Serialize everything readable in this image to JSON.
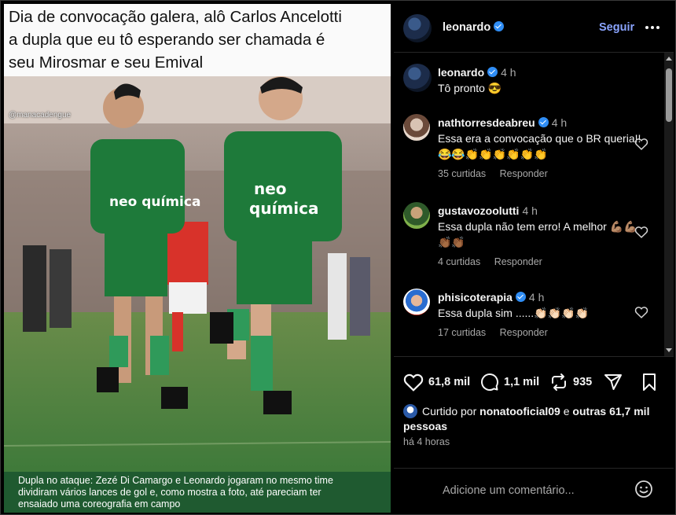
{
  "post": {
    "image_caption_lines": [
      "Dia de convocação galera, alô Carlos Ancelotti",
      "a dupla que eu tô esperando ser chamada é",
      "seu Mirosmar e seu Emival"
    ],
    "watermark": "@manacadengue",
    "shirt_text": "neo química",
    "photo_caption_lines": [
      "Dupla no ataque: Zezé Di Camargo e Leonardo jogaram no mesmo time",
      "dividiram vários lances de gol e, como mostra a foto, até pareciam ter",
      "ensaiado uma coreografia em campo"
    ]
  },
  "header": {
    "username": "leonardo",
    "follow_label": "Seguir",
    "more_icon": "more-horizontal-icon"
  },
  "comments": [
    {
      "username": "leonardo",
      "verified": true,
      "time": "4 h",
      "text": "Tô pronto 😎",
      "likes": "",
      "reply": ""
    },
    {
      "username": "nathtorresdeabreu",
      "verified": true,
      "time": "4 h",
      "text": "Essa era a convocação que o BR queria!! 😂😂👏👏👏👏👏👏",
      "likes": "35 curtidas",
      "reply": "Responder"
    },
    {
      "username": "gustavozoolutti",
      "verified": false,
      "time": "4 h",
      "text": "Essa dupla não tem erro! A melhor 💪🏽💪🏽👏🏾👏🏾",
      "likes": "4 curtidas",
      "reply": "Responder"
    },
    {
      "username": "phisicoterapia",
      "verified": true,
      "time": "4 h",
      "text": "Essa dupla sim ......👏🏻👏🏻👏🏻👏🏻",
      "likes": "17 curtidas",
      "reply": "Responder"
    }
  ],
  "actions": {
    "likes_count": "61,8 mil",
    "comments_count": "1,1 mil",
    "reposts_count": "935"
  },
  "liked_by": {
    "prefix": "Curtido por",
    "user": "nonatooficial09",
    "middle": "e",
    "others": "outras 61,7 mil pessoas"
  },
  "posted_ago": "há 4 horas",
  "add_comment": {
    "placeholder": "Adicione um comentário..."
  }
}
